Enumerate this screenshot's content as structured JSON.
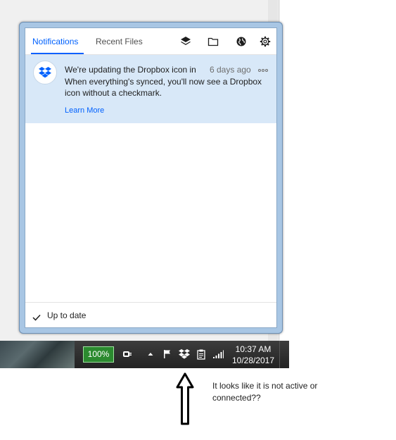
{
  "popup": {
    "tabs": [
      {
        "label": "Notifications",
        "active": true
      },
      {
        "label": "Recent Files",
        "active": false
      }
    ],
    "toolbar_icons": [
      "dropbox-layers-icon",
      "folder-icon",
      "globe-icon",
      "gear-icon"
    ],
    "notification": {
      "title": "We're updating the Dropbox icon in",
      "time": "6 days ago",
      "body": "When everything's synced, you'll now see a Dropbox icon without a checkmark.",
      "link": "Learn More"
    },
    "status": "Up to date"
  },
  "taskbar": {
    "battery": "100%",
    "clock_time": "10:37 AM",
    "clock_date": "10/28/2017",
    "tray_icons": [
      "power-plug-icon",
      "show-hidden-icons-arrow",
      "action-center-flag-icon",
      "dropbox-tray-icon",
      "clipboard-icon",
      "signal-bars-icon"
    ]
  },
  "annotation": {
    "text": "It looks like it is not active or connected??"
  },
  "colors": {
    "accent": "#0061fe",
    "notification_bg": "#d8e8f8",
    "battery_green": "#2b8a2f"
  }
}
